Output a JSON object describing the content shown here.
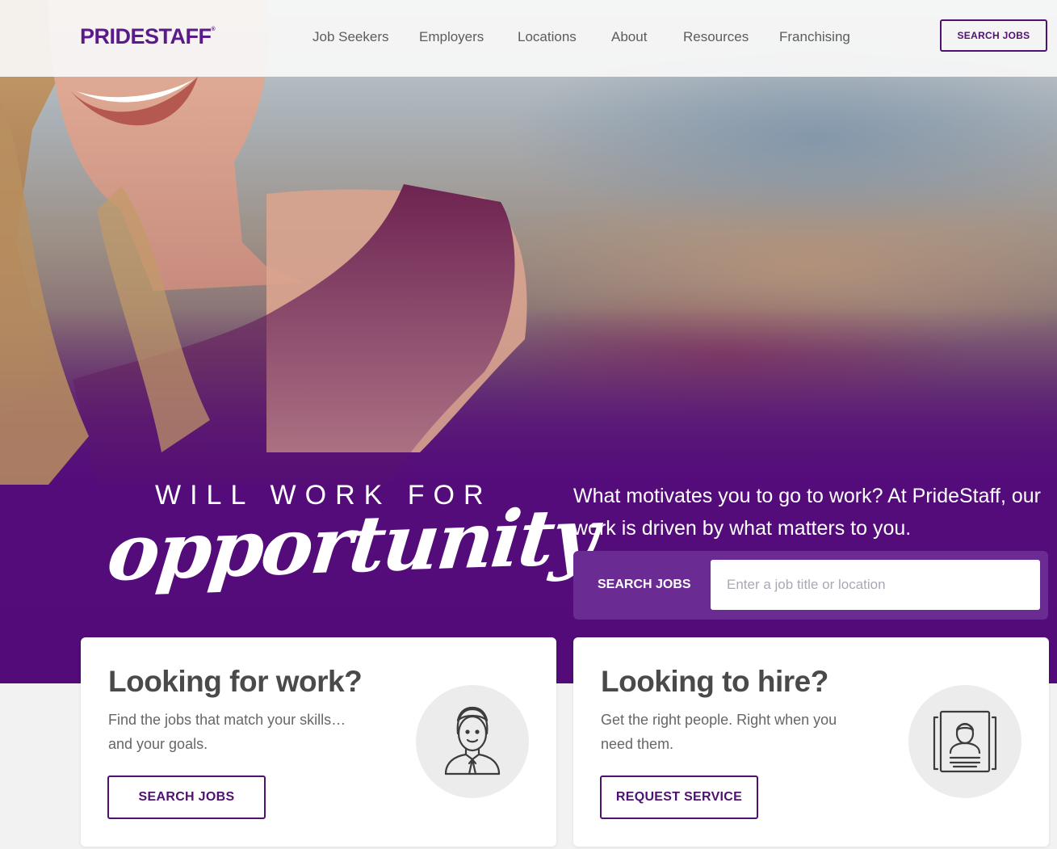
{
  "brand": {
    "logo_text": "PRIDESTAFF",
    "logo_mark": "®",
    "primary_color": "#4f1170",
    "hero_purple": "#520b78"
  },
  "header": {
    "nav": [
      {
        "label": "Job Seekers"
      },
      {
        "label": "Employers"
      },
      {
        "label": "Locations"
      },
      {
        "label": "About"
      },
      {
        "label": "Resources"
      },
      {
        "label": "Franchising"
      }
    ],
    "cta_label": "SEARCH JOBS"
  },
  "hero": {
    "tagline_top": "WILL WORK FOR",
    "tagline_script": "opportunity",
    "intro": "What motivates you to go to work? At PrideStaff, our work is driven by what matters to you.",
    "search": {
      "label": "SEARCH JOBS",
      "placeholder": "Enter a job title or location",
      "value": ""
    }
  },
  "cards": [
    {
      "title": "Looking for work?",
      "description": "Find the jobs that match your skills… and your goals.",
      "button_label": "SEARCH JOBS",
      "icon": "job-seeker-icon"
    },
    {
      "title": "Looking to hire?",
      "description": "Get the right people. Right when you need them.",
      "button_label": "REQUEST SERVICE",
      "icon": "resume-profile-icon"
    }
  ]
}
